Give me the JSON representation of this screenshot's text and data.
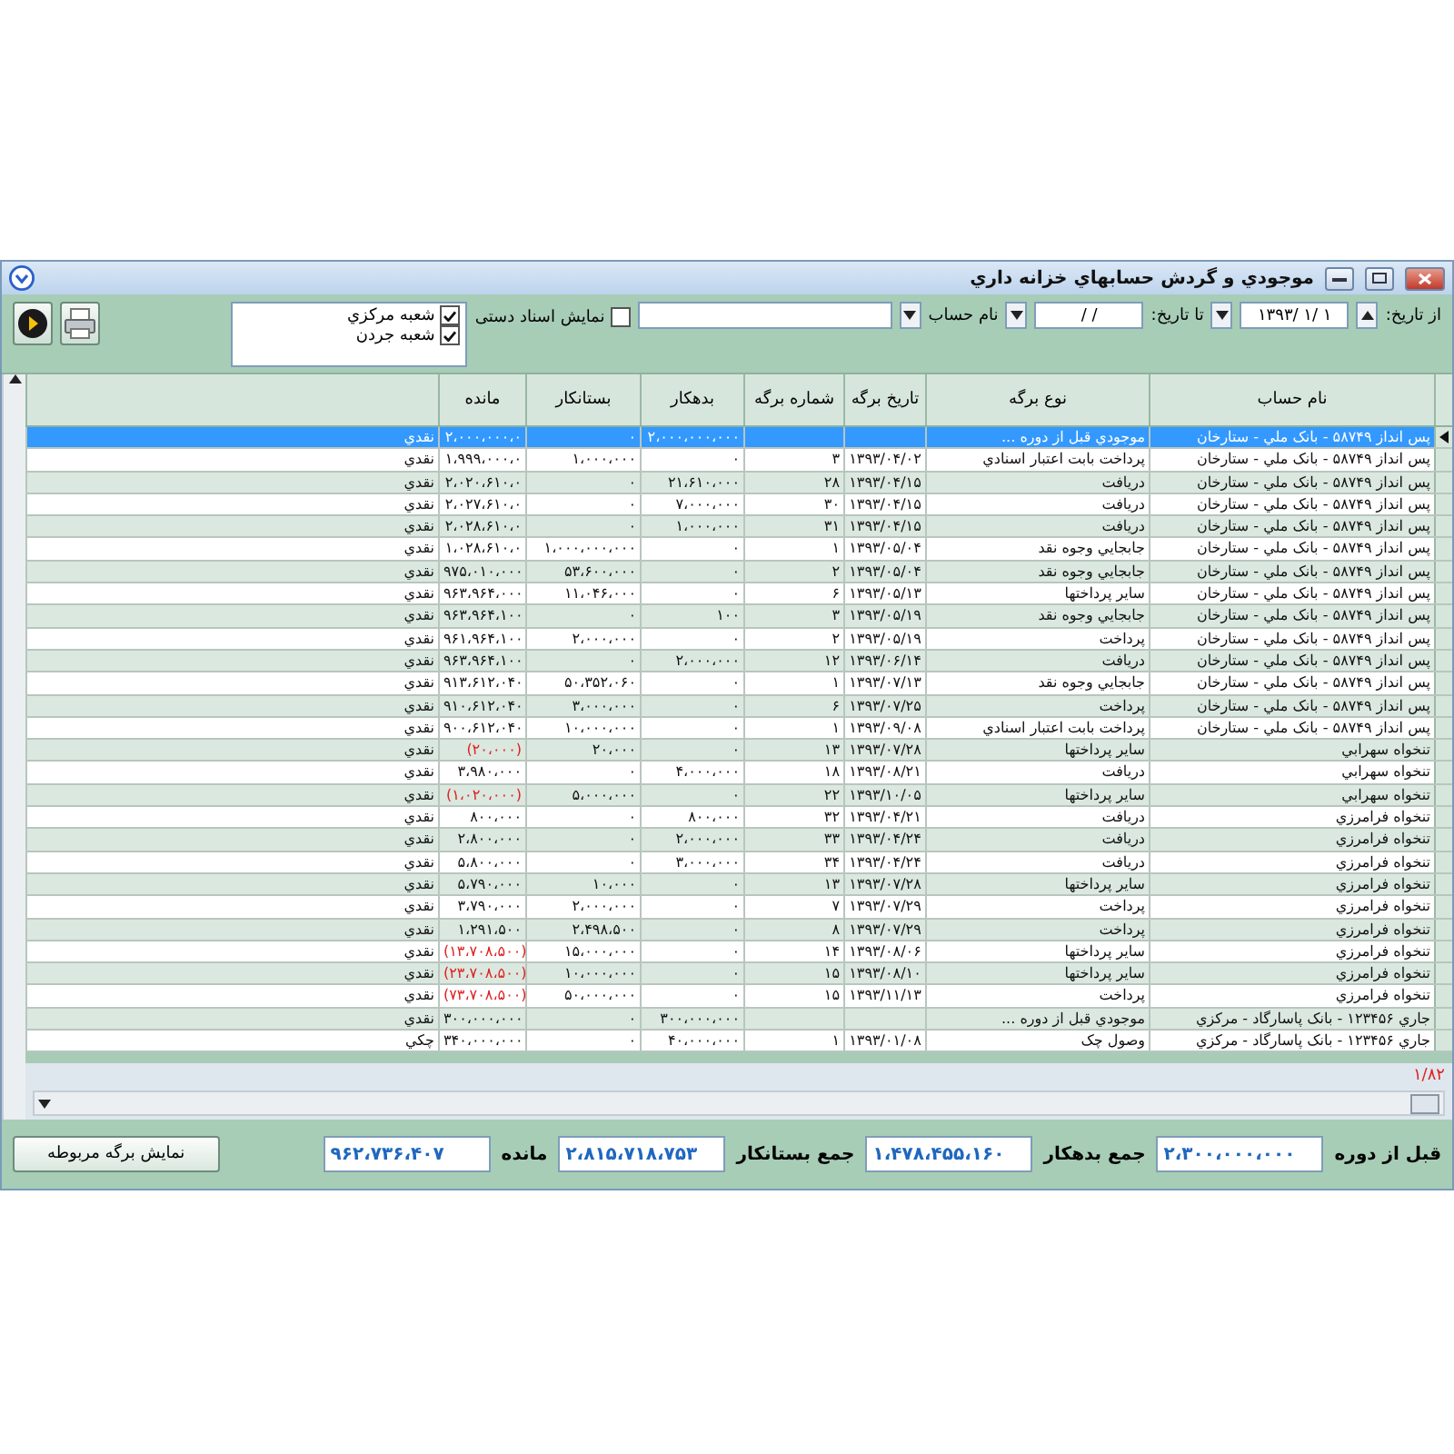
{
  "window": {
    "title": "موجودي و گردش حسابهاي خزانه داري"
  },
  "filters": {
    "from_label": "از تاریخ:",
    "from_date": "۱۳۹۳/ ۱/ ۱",
    "to_label": "تا تاریخ:",
    "to_date": "/   /",
    "account_label": "نام حساب",
    "manual_docs": {
      "label": "نمایش اسناد دستی",
      "checked": false
    },
    "branches": [
      {
        "label": "شعبه مرکزي",
        "checked": true
      },
      {
        "label": "شعبه جردن",
        "checked": true
      }
    ]
  },
  "table": {
    "columns": [
      "نام حساب",
      "نوع برگه",
      "تاریخ برگه",
      "شماره برگه",
      "بدهکار",
      "بستانکار",
      "مانده"
    ],
    "rows": [
      {
        "cells": [
          "پس انداز ۵۸۷۴۹ - بانک ملي - ستارخان",
          "موجودي قبل از دوره ...",
          "",
          "",
          "۲،۰۰۰،۰۰۰،۰۰۰",
          "۰",
          "۲،۰۰۰،۰۰۰،۰",
          "نقدي"
        ],
        "selected": true,
        "negative": false
      },
      {
        "cells": [
          "پس انداز ۵۸۷۴۹ - بانک ملي - ستارخان",
          "پرداخت بابت اعتبار اسنادي",
          "۱۳۹۳/۰۴/۰۲",
          "۳",
          "۰",
          "۱،۰۰۰،۰۰۰",
          "۱،۹۹۹،۰۰۰،۰",
          "نقدي"
        ],
        "selected": false,
        "negative": false
      },
      {
        "cells": [
          "پس انداز ۵۸۷۴۹ - بانک ملي - ستارخان",
          "دريافت",
          "۱۳۹۳/۰۴/۱۵",
          "۲۸",
          "۲۱،۶۱۰،۰۰۰",
          "۰",
          "۲،۰۲۰،۶۱۰،۰",
          "نقدي"
        ],
        "selected": false,
        "negative": false
      },
      {
        "cells": [
          "پس انداز ۵۸۷۴۹ - بانک ملي - ستارخان",
          "دريافت",
          "۱۳۹۳/۰۴/۱۵",
          "۳۰",
          "۷،۰۰۰،۰۰۰",
          "۰",
          "۲،۰۲۷،۶۱۰،۰",
          "نقدي"
        ],
        "selected": false,
        "negative": false
      },
      {
        "cells": [
          "پس انداز ۵۸۷۴۹ - بانک ملي - ستارخان",
          "دريافت",
          "۱۳۹۳/۰۴/۱۵",
          "۳۱",
          "۱،۰۰۰،۰۰۰",
          "۰",
          "۲،۰۲۸،۶۱۰،۰",
          "نقدي"
        ],
        "selected": false,
        "negative": false
      },
      {
        "cells": [
          "پس انداز ۵۸۷۴۹ - بانک ملي - ستارخان",
          "جابجايي وجوه نقد",
          "۱۳۹۳/۰۵/۰۴",
          "۱",
          "۰",
          "۱،۰۰۰،۰۰۰،۰۰۰",
          "۱،۰۲۸،۶۱۰،۰",
          "نقدي"
        ],
        "selected": false,
        "negative": false
      },
      {
        "cells": [
          "پس انداز ۵۸۷۴۹ - بانک ملي - ستارخان",
          "جابجايي وجوه نقد",
          "۱۳۹۳/۰۵/۰۴",
          "۲",
          "۰",
          "۵۳،۶۰۰،۰۰۰",
          "۹۷۵،۰۱۰،۰۰۰",
          "نقدي"
        ],
        "selected": false,
        "negative": false
      },
      {
        "cells": [
          "پس انداز ۵۸۷۴۹ - بانک ملي - ستارخان",
          "ساير پرداختها",
          "۱۳۹۳/۰۵/۱۳",
          "۶",
          "۰",
          "۱۱،۰۴۶،۰۰۰",
          "۹۶۳،۹۶۴،۰۰۰",
          "نقدي"
        ],
        "selected": false,
        "negative": false
      },
      {
        "cells": [
          "پس انداز ۵۸۷۴۹ - بانک ملي - ستارخان",
          "جابجايي وجوه نقد",
          "۱۳۹۳/۰۵/۱۹",
          "۳",
          "۱۰۰",
          "۰",
          "۹۶۳،۹۶۴،۱۰۰",
          "نقدي"
        ],
        "selected": false,
        "negative": false
      },
      {
        "cells": [
          "پس انداز ۵۸۷۴۹ - بانک ملي - ستارخان",
          "پرداخت",
          "۱۳۹۳/۰۵/۱۹",
          "۲",
          "۰",
          "۲،۰۰۰،۰۰۰",
          "۹۶۱،۹۶۴،۱۰۰",
          "نقدي"
        ],
        "selected": false,
        "negative": false
      },
      {
        "cells": [
          "پس انداز ۵۸۷۴۹ - بانک ملي - ستارخان",
          "دريافت",
          "۱۳۹۳/۰۶/۱۴",
          "۱۲",
          "۲،۰۰۰،۰۰۰",
          "۰",
          "۹۶۳،۹۶۴،۱۰۰",
          "نقدي"
        ],
        "selected": false,
        "negative": false
      },
      {
        "cells": [
          "پس انداز ۵۸۷۴۹ - بانک ملي - ستارخان",
          "جابجايي وجوه نقد",
          "۱۳۹۳/۰۷/۱۳",
          "۱",
          "۰",
          "۵۰،۳۵۲،۰۶۰",
          "۹۱۳،۶۱۲،۰۴۰",
          "نقدي"
        ],
        "selected": false,
        "negative": false
      },
      {
        "cells": [
          "پس انداز ۵۸۷۴۹ - بانک ملي - ستارخان",
          "پرداخت",
          "۱۳۹۳/۰۷/۲۵",
          "۶",
          "۰",
          "۳،۰۰۰،۰۰۰",
          "۹۱۰،۶۱۲،۰۴۰",
          "نقدي"
        ],
        "selected": false,
        "negative": false
      },
      {
        "cells": [
          "پس انداز ۵۸۷۴۹ - بانک ملي - ستارخان",
          "پرداخت بابت اعتبار اسنادي",
          "۱۳۹۳/۰۹/۰۸",
          "۱",
          "۰",
          "۱۰،۰۰۰،۰۰۰",
          "۹۰۰،۶۱۲،۰۴۰",
          "نقدي"
        ],
        "selected": false,
        "negative": false
      },
      {
        "cells": [
          "تنخواه  سهرابي",
          "ساير پرداختها",
          "۱۳۹۳/۰۷/۲۸",
          "۱۳",
          "۰",
          "۲۰،۰۰۰",
          "(۲۰،۰۰۰)",
          "نقدي"
        ],
        "selected": false,
        "negative": true
      },
      {
        "cells": [
          "تنخواه  سهرابي",
          "دريافت",
          "۱۳۹۳/۰۸/۲۱",
          "۱۸",
          "۴،۰۰۰،۰۰۰",
          "۰",
          "۳،۹۸۰،۰۰۰",
          "نقدي"
        ],
        "selected": false,
        "negative": false
      },
      {
        "cells": [
          "تنخواه  سهرابي",
          "ساير پرداختها",
          "۱۳۹۳/۱۰/۰۵",
          "۲۲",
          "۰",
          "۵،۰۰۰،۰۰۰",
          "(۱،۰۲۰،۰۰۰)",
          "نقدي"
        ],
        "selected": false,
        "negative": true
      },
      {
        "cells": [
          "تنخواه فرامرزي",
          "دريافت",
          "۱۳۹۳/۰۴/۲۱",
          "۳۲",
          "۸۰۰،۰۰۰",
          "۰",
          "۸۰۰،۰۰۰",
          "نقدي"
        ],
        "selected": false,
        "negative": false
      },
      {
        "cells": [
          "تنخواه فرامرزي",
          "دريافت",
          "۱۳۹۳/۰۴/۲۴",
          "۳۳",
          "۲،۰۰۰،۰۰۰",
          "۰",
          "۲،۸۰۰،۰۰۰",
          "نقدي"
        ],
        "selected": false,
        "negative": false
      },
      {
        "cells": [
          "تنخواه فرامرزي",
          "دريافت",
          "۱۳۹۳/۰۴/۲۴",
          "۳۴",
          "۳،۰۰۰،۰۰۰",
          "۰",
          "۵،۸۰۰،۰۰۰",
          "نقدي"
        ],
        "selected": false,
        "negative": false
      },
      {
        "cells": [
          "تنخواه فرامرزي",
          "ساير پرداختها",
          "۱۳۹۳/۰۷/۲۸",
          "۱۳",
          "۰",
          "۱۰،۰۰۰",
          "۵،۷۹۰،۰۰۰",
          "نقدي"
        ],
        "selected": false,
        "negative": false
      },
      {
        "cells": [
          "تنخواه فرامرزي",
          "پرداخت",
          "۱۳۹۳/۰۷/۲۹",
          "۷",
          "۰",
          "۲،۰۰۰،۰۰۰",
          "۳،۷۹۰،۰۰۰",
          "نقدي"
        ],
        "selected": false,
        "negative": false
      },
      {
        "cells": [
          "تنخواه فرامرزي",
          "پرداخت",
          "۱۳۹۳/۰۷/۲۹",
          "۸",
          "۰",
          "۲،۴۹۸،۵۰۰",
          "۱،۲۹۱،۵۰۰",
          "نقدي"
        ],
        "selected": false,
        "negative": false
      },
      {
        "cells": [
          "تنخواه فرامرزي",
          "ساير پرداختها",
          "۱۳۹۳/۰۸/۰۶",
          "۱۴",
          "۰",
          "۱۵،۰۰۰،۰۰۰",
          "(۱۳،۷۰۸،۵۰۰)",
          "نقدي"
        ],
        "selected": false,
        "negative": true
      },
      {
        "cells": [
          "تنخواه فرامرزي",
          "ساير پرداختها",
          "۱۳۹۳/۰۸/۱۰",
          "۱۵",
          "۰",
          "۱۰،۰۰۰،۰۰۰",
          "(۲۳،۷۰۸،۵۰۰)",
          "نقدي"
        ],
        "selected": false,
        "negative": true
      },
      {
        "cells": [
          "تنخواه فرامرزي",
          "پرداخت",
          "۱۳۹۳/۱۱/۱۳",
          "۱۵",
          "۰",
          "۵۰،۰۰۰،۰۰۰",
          "(۷۳،۷۰۸،۵۰۰)",
          "نقدي"
        ],
        "selected": false,
        "negative": true
      },
      {
        "cells": [
          "جاري ۱۲۳۴۵۶ - بانک پاسارگاد - مرکزي",
          "موجودي قبل از دوره ...",
          "",
          "",
          "۳۰۰،۰۰۰،۰۰۰",
          "۰",
          "۳۰۰،۰۰۰،۰۰۰",
          "نقدي"
        ],
        "selected": false,
        "negative": false
      },
      {
        "cells": [
          "جاري ۱۲۳۴۵۶ - بانک پاسارگاد - مرکزي",
          "وصول چک",
          "۱۳۹۳/۰۱/۰۸",
          "۱",
          "۴۰،۰۰۰،۰۰۰",
          "۰",
          "۳۴۰،۰۰۰،۰۰۰",
          "چکي"
        ],
        "selected": false,
        "negative": false
      }
    ]
  },
  "pager": "۱/۸۲",
  "totals": [
    {
      "label": "قبل از دوره",
      "value": "۲،۳۰۰،۰۰۰،۰۰۰"
    },
    {
      "label": "جمع بدهکار",
      "value": "۱،۴۷۸،۴۵۵،۱۶۰"
    },
    {
      "label": "جمع بستانکار",
      "value": "۲،۸۱۵،۷۱۸،۷۵۳"
    },
    {
      "label": "مانده",
      "value": "۹۶۲،۷۳۶،۴۰۷"
    }
  ],
  "buttons": [
    "نمایش برگه مربوطه"
  ]
}
